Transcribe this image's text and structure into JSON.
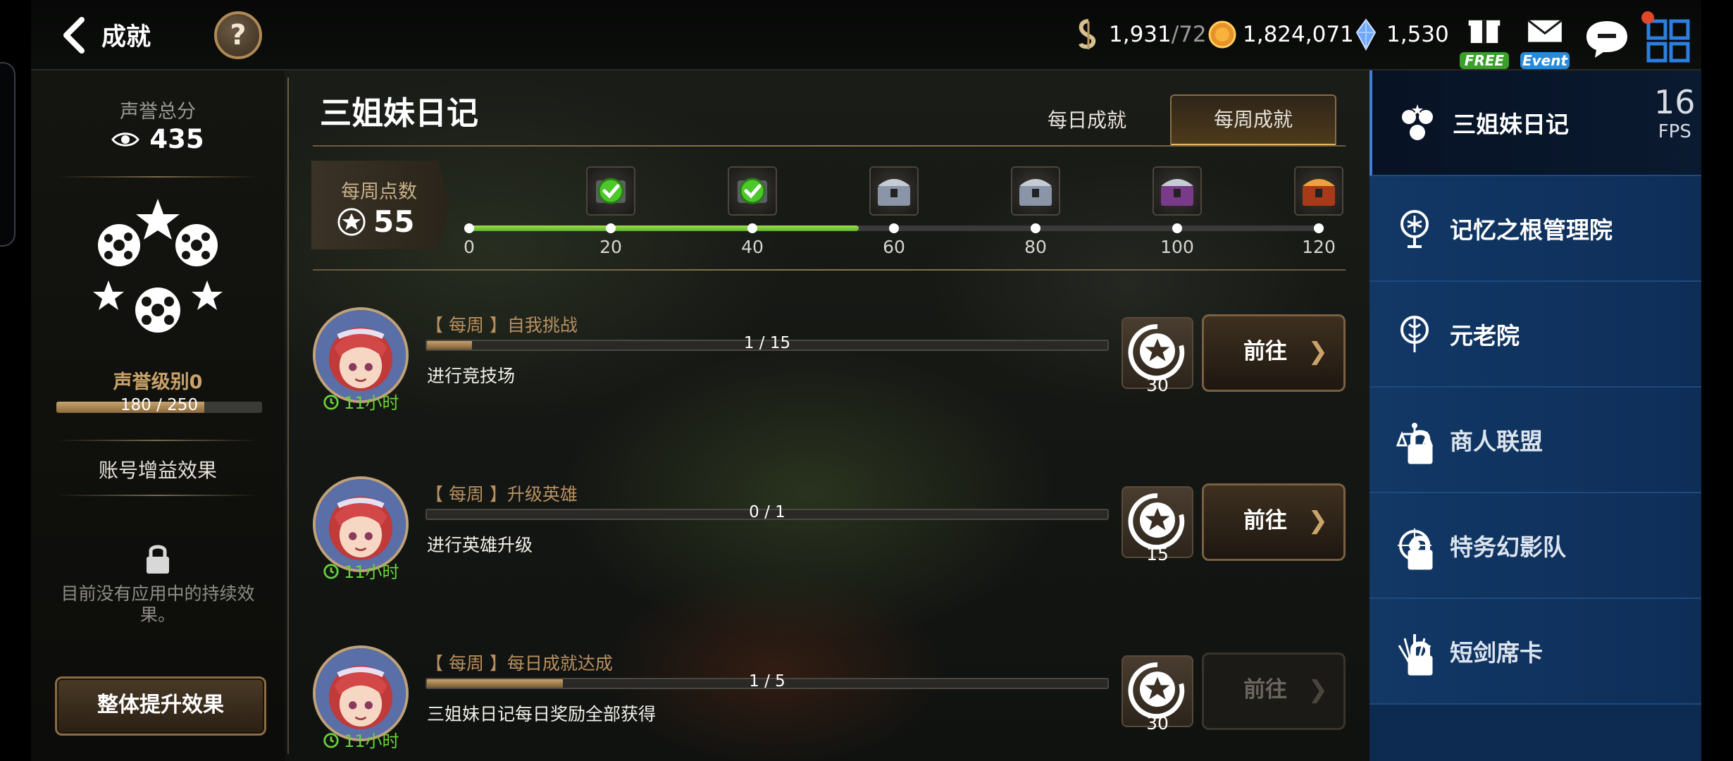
{
  "header": {
    "title": "成就",
    "help": "?",
    "stamina": {
      "value": "1,931",
      "max": "/72"
    },
    "gold": "1,824,071",
    "crystal": "1,530",
    "free_tag": "FREE",
    "event_tag": "Event"
  },
  "left_panel": {
    "reputation_total_label": "声誉总分",
    "reputation_total_value": "435",
    "reputation_level": "声誉级别0",
    "reputation_progress_text": "180 / 250",
    "reputation_progress": 0.72,
    "account_buff_label": "账号增益效果",
    "no_effect_text": "目前没有应用中的持续效果。",
    "whole_boost_button": "整体提升效果"
  },
  "main": {
    "title": "三姐妹日记",
    "tabs": [
      {
        "label": "每日成就",
        "active": false
      },
      {
        "label": "每周成就",
        "active": true
      }
    ],
    "weekly_points_label": "每周点数",
    "weekly_points_value": "55",
    "track": {
      "max": 120,
      "current": 55,
      "ticks": [
        "0",
        "20",
        "40",
        "60",
        "80",
        "100",
        "120"
      ],
      "rewards": [
        {
          "at": 20,
          "kind": "claimed"
        },
        {
          "at": 40,
          "kind": "claimed"
        },
        {
          "at": 60,
          "kind": "silver-chest"
        },
        {
          "at": 80,
          "kind": "silver-chest"
        },
        {
          "at": 100,
          "kind": "purple-chest"
        },
        {
          "at": 120,
          "kind": "red-chest"
        }
      ]
    },
    "quests": [
      {
        "title": "【 每周 】自我挑战",
        "progress_text": "1 / 15",
        "progress": 0.0667,
        "desc": "进行竞技场",
        "timer": "11小时",
        "reward": "30",
        "button": "前往",
        "enabled": true
      },
      {
        "title": "【 每周 】升级英雄",
        "progress_text": "0 / 1",
        "progress": 0,
        "desc": "进行英雄升级",
        "timer": "11小时",
        "reward": "15",
        "button": "前往",
        "enabled": true
      },
      {
        "title": "【 每周 】每日成就达成",
        "progress_text": "1 / 5",
        "progress": 0.2,
        "desc": "三姐妹日记每日奖励全部获得",
        "timer": "11小时",
        "reward": "30",
        "button": "前往",
        "enabled": false
      }
    ]
  },
  "sidebar": {
    "items": [
      {
        "label": "三姐妹日记",
        "active": true,
        "locked": false
      },
      {
        "label": "记忆之根管理院",
        "active": false,
        "locked": false
      },
      {
        "label": "元老院",
        "active": false,
        "locked": false
      },
      {
        "label": "商人联盟",
        "active": false,
        "locked": true
      },
      {
        "label": "特务幻影队",
        "active": false,
        "locked": true
      },
      {
        "label": "短剑席卡",
        "active": false,
        "locked": true
      }
    ]
  },
  "fps": {
    "value": "16",
    "unit": "FPS"
  },
  "colors": {
    "accent_gold": "#c9a36a",
    "progress_green": "#6ad13a",
    "sidebar_blue": "#123866"
  }
}
